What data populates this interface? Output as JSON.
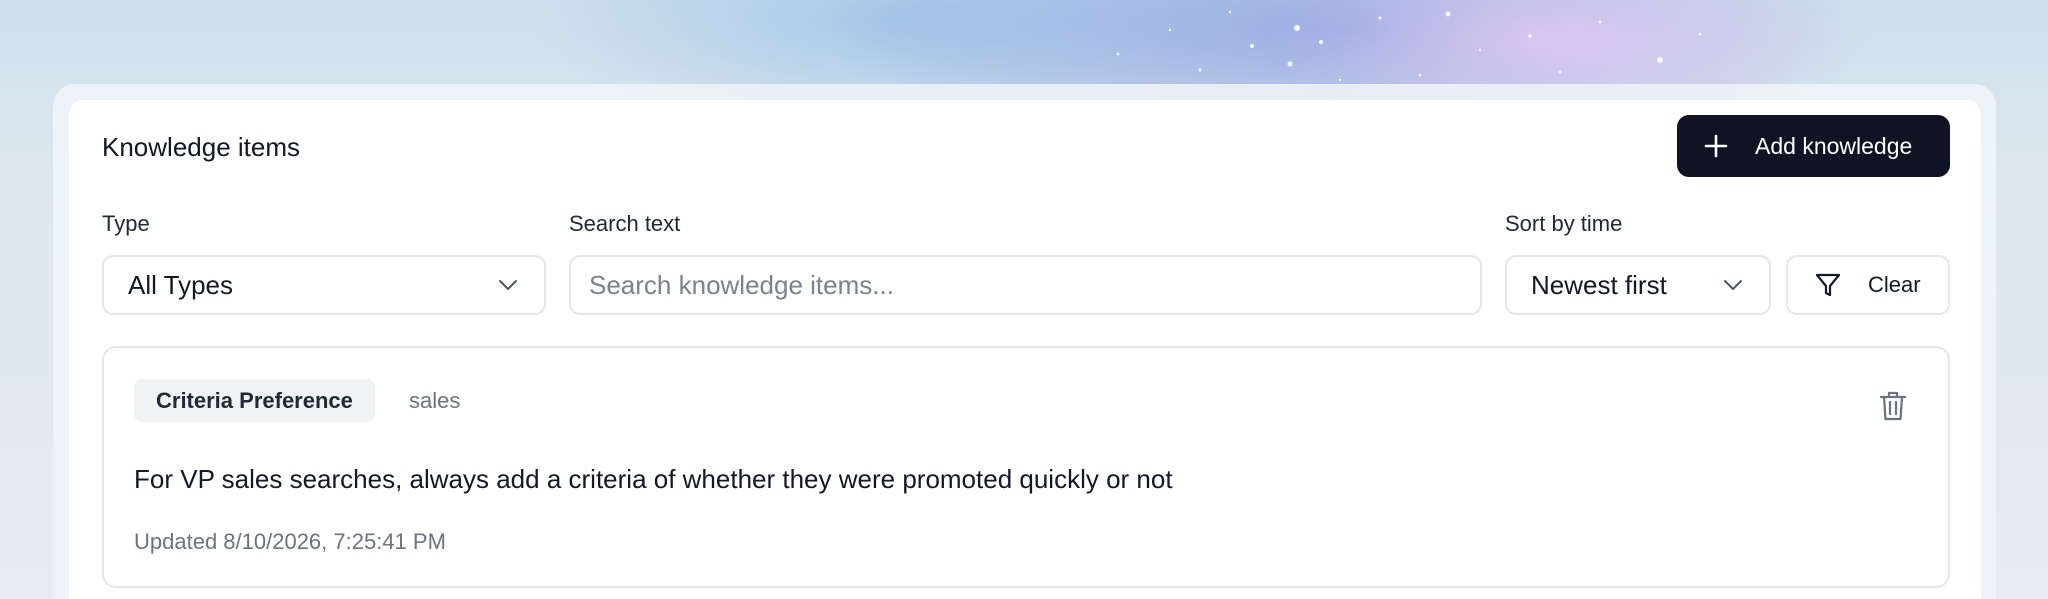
{
  "header": {
    "title": "Knowledge items",
    "add_button_label": "Add knowledge"
  },
  "filters": {
    "type_label": "Type",
    "type_value": "All Types",
    "search_label": "Search text",
    "search_placeholder": "Search knowledge items...",
    "search_value": "",
    "sort_label": "Sort by time",
    "sort_value": "Newest first",
    "clear_label": "Clear"
  },
  "items": [
    {
      "tag": "Criteria Preference",
      "category": "sales",
      "content": "For VP sales searches, always add a criteria of whether they were promoted quickly or not",
      "updated": "Updated 8/10/2026, 7:25:41 PM"
    }
  ],
  "icons": {
    "add": "plus-icon",
    "type_dropdown": "chevron-down-icon",
    "sort_dropdown": "chevron-down-icon",
    "clear": "filter-icon",
    "delete": "trash-icon"
  },
  "colors": {
    "primary_button": "#0f1424",
    "border": "#e3e6eb",
    "tag_background": "#f1f2f4",
    "muted_text": "#6b7280"
  }
}
